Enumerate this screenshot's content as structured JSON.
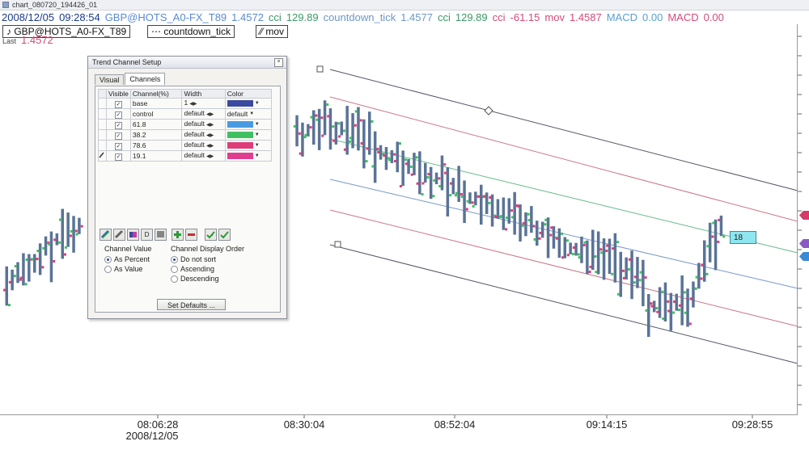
{
  "window": {
    "title": "chart_080720_194426_01"
  },
  "infoline": [
    {
      "text": "2008/12/05",
      "color": "#1a3a8a"
    },
    {
      "text": "09:28:54",
      "color": "#1a3a8a"
    },
    {
      "text": "GBP@HOTS_A0-FX_T89",
      "color": "#5a8ad0"
    },
    {
      "text": "1.4572",
      "color": "#5a8ad0"
    },
    {
      "text": "cci",
      "color": "#3a9a66"
    },
    {
      "text": "129.89",
      "color": "#3a9a66"
    },
    {
      "text": "countdown_tick",
      "color": "#6a98c8"
    },
    {
      "text": "1.4577",
      "color": "#6a98c8"
    },
    {
      "text": "cci",
      "color": "#3a9a66"
    },
    {
      "text": "129.89",
      "color": "#3a9a66"
    },
    {
      "text": "cci",
      "color": "#d44a7a"
    },
    {
      "text": "-61.15",
      "color": "#d44a7a"
    },
    {
      "text": "mov",
      "color": "#d44a7a"
    },
    {
      "text": "1.4587",
      "color": "#d44a7a"
    },
    {
      "text": "MACD",
      "color": "#5aa0d0"
    },
    {
      "text": "0.00",
      "color": "#5aa0d0"
    },
    {
      "text": "MACD",
      "color": "#d44a7a"
    },
    {
      "text": "0.00",
      "color": "#d44a7a"
    }
  ],
  "tabs": [
    {
      "label": "GBP@HOTS_A0-FX_T89",
      "glyph": "♪"
    },
    {
      "label": "countdown_tick",
      "glyph": "⋯"
    },
    {
      "label": "mov",
      "glyph": "⁄⁄"
    }
  ],
  "last": {
    "label": "Last",
    "value": "1.4572"
  },
  "current_label": "18",
  "xaxis": {
    "ticks": [
      "08:06:28",
      "08:30:04",
      "08:52:04",
      "09:14:15",
      "09:28:55"
    ],
    "date": "2008/12/05"
  },
  "colors": {
    "candle": "#5a7396",
    "up": "#3ec060",
    "down": "#e03c7a",
    "ch_outer": "#555566",
    "ch_red": "#cc7788",
    "ch_green": "#66bb88",
    "ch_blue": "#7799cc",
    "edge_red": "#d63a6a",
    "edge_purple": "#8a5ac0",
    "edge_blue": "#3a8ad6"
  },
  "dialog": {
    "title": "Trend Channel Setup",
    "close_icon": "close-icon",
    "tabs": [
      "Visual",
      "Channels"
    ],
    "active_tab": "Channels",
    "columns": [
      "Visible",
      "Channel(%)",
      "Width",
      "Color"
    ],
    "rows": [
      {
        "channel": "base",
        "width": "1",
        "color_text": "",
        "color": "#3a4aa0"
      },
      {
        "channel": "control",
        "width": "default",
        "color_text": "default",
        "color": ""
      },
      {
        "channel": "61.8",
        "width": "default",
        "color_text": "",
        "color": "#4a9ae0"
      },
      {
        "channel": "38.2",
        "width": "default",
        "color_text": "",
        "color": "#3ec060"
      },
      {
        "channel": "78.6",
        "width": "default",
        "color_text": "",
        "color": "#e03c7a"
      },
      {
        "channel": "19.1",
        "width": "default",
        "color_text": "",
        "color": "#e03c90"
      }
    ],
    "toolbar": {
      "d_label": "D"
    },
    "channel_value": {
      "label": "Channel Value",
      "options": [
        "As Percent",
        "As Value"
      ],
      "selected": 0
    },
    "display_order": {
      "label": "Channel Display Order",
      "options": [
        "Do not sort",
        "Ascending",
        "Descending"
      ],
      "selected": 0
    },
    "set_defaults_label": "Set Defaults ..."
  },
  "chart_data": {
    "type": "candlestick",
    "x": [
      "08:06:28",
      "08:30:04",
      "08:52:04",
      "09:14:15",
      "09:28:55"
    ],
    "date": "2008/12/05",
    "last_value": 1.4572,
    "channels": [
      "base",
      "control",
      "61.8",
      "38.2",
      "78.6",
      "19.1"
    ],
    "label": "18"
  }
}
